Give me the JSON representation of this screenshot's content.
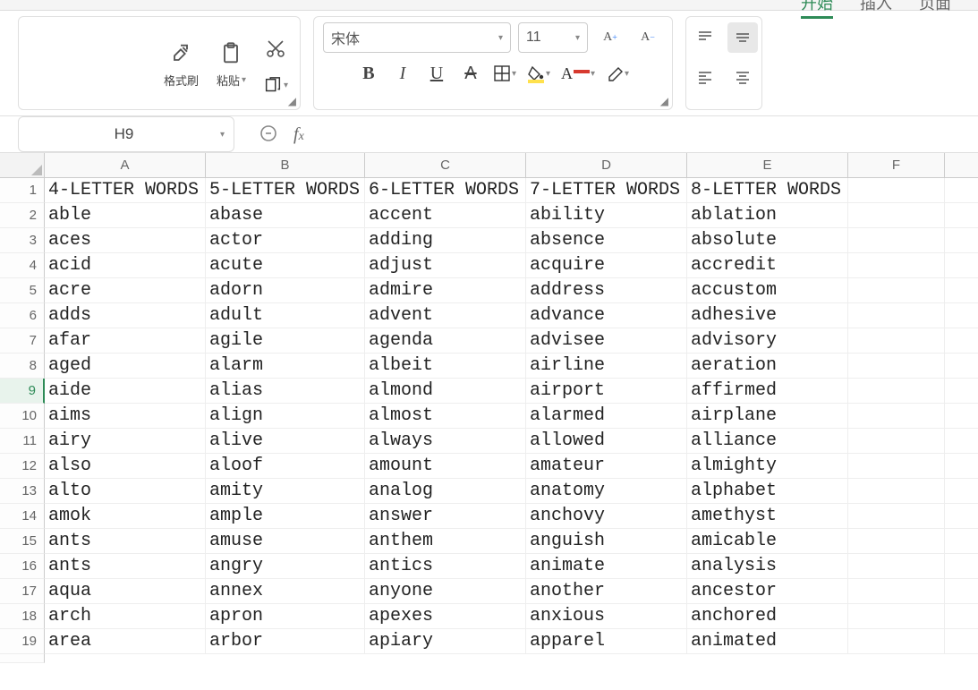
{
  "menu": {
    "tabs": [
      "开始",
      "插入",
      "页面"
    ],
    "active": 0
  },
  "ribbon": {
    "format_painter": "格式刷",
    "paste": "粘贴",
    "font_name": "宋体",
    "font_size": "11"
  },
  "namebox": "H9",
  "formula": "",
  "columns": [
    "A",
    "B",
    "C",
    "D",
    "E",
    "F"
  ],
  "active_row_index": 8,
  "rows": [
    {
      "n": 1,
      "cells": [
        "4-LETTER WORDS",
        "5-LETTER WORDS",
        "6-LETTER WORDS",
        "7-LETTER WORDS",
        "8-LETTER WORDS",
        ""
      ]
    },
    {
      "n": 2,
      "cells": [
        "able",
        "abase",
        "accent",
        "ability",
        "ablation",
        ""
      ]
    },
    {
      "n": 3,
      "cells": [
        "aces",
        "actor",
        "adding",
        "absence",
        "absolute",
        ""
      ]
    },
    {
      "n": 4,
      "cells": [
        "acid",
        "acute",
        "adjust",
        "acquire",
        "accredit",
        ""
      ]
    },
    {
      "n": 5,
      "cells": [
        "acre",
        "adorn",
        "admire",
        "address",
        "accustom",
        ""
      ]
    },
    {
      "n": 6,
      "cells": [
        "adds",
        "adult",
        "advent",
        "advance",
        "adhesive",
        ""
      ]
    },
    {
      "n": 7,
      "cells": [
        "afar",
        "agile",
        "agenda",
        "advisee",
        "advisory",
        ""
      ]
    },
    {
      "n": 8,
      "cells": [
        "aged",
        "alarm",
        "albeit",
        "airline",
        "aeration",
        ""
      ]
    },
    {
      "n": 9,
      "cells": [
        "aide",
        "alias",
        "almond",
        "airport",
        "affirmed",
        ""
      ]
    },
    {
      "n": 10,
      "cells": [
        "aims",
        "align",
        "almost",
        "alarmed",
        "airplane",
        ""
      ]
    },
    {
      "n": 11,
      "cells": [
        "airy",
        "alive",
        "always",
        "allowed",
        "alliance",
        ""
      ]
    },
    {
      "n": 12,
      "cells": [
        "also",
        "aloof",
        "amount",
        "amateur",
        "almighty",
        ""
      ]
    },
    {
      "n": 13,
      "cells": [
        "alto",
        "amity",
        "analog",
        "anatomy",
        "alphabet",
        ""
      ]
    },
    {
      "n": 14,
      "cells": [
        "amok",
        "ample",
        "answer",
        "anchovy",
        "amethyst",
        ""
      ]
    },
    {
      "n": 15,
      "cells": [
        "ants",
        "amuse",
        "anthem",
        "anguish",
        "amicable",
        ""
      ]
    },
    {
      "n": 16,
      "cells": [
        "ants",
        "angry",
        "antics",
        "animate",
        "analysis",
        ""
      ]
    },
    {
      "n": 17,
      "cells": [
        "aqua",
        "annex",
        "anyone",
        "another",
        "ancestor",
        ""
      ]
    },
    {
      "n": 18,
      "cells": [
        "arch",
        "apron",
        "apexes",
        "anxious",
        "anchored",
        ""
      ]
    },
    {
      "n": 19,
      "cells": [
        "area",
        "arbor",
        "apiary",
        "apparel",
        "animated",
        ""
      ]
    }
  ],
  "colors": {
    "accent": "#2e8b57",
    "highlight": "#ffe14d",
    "font_color": "#d73a2f"
  }
}
